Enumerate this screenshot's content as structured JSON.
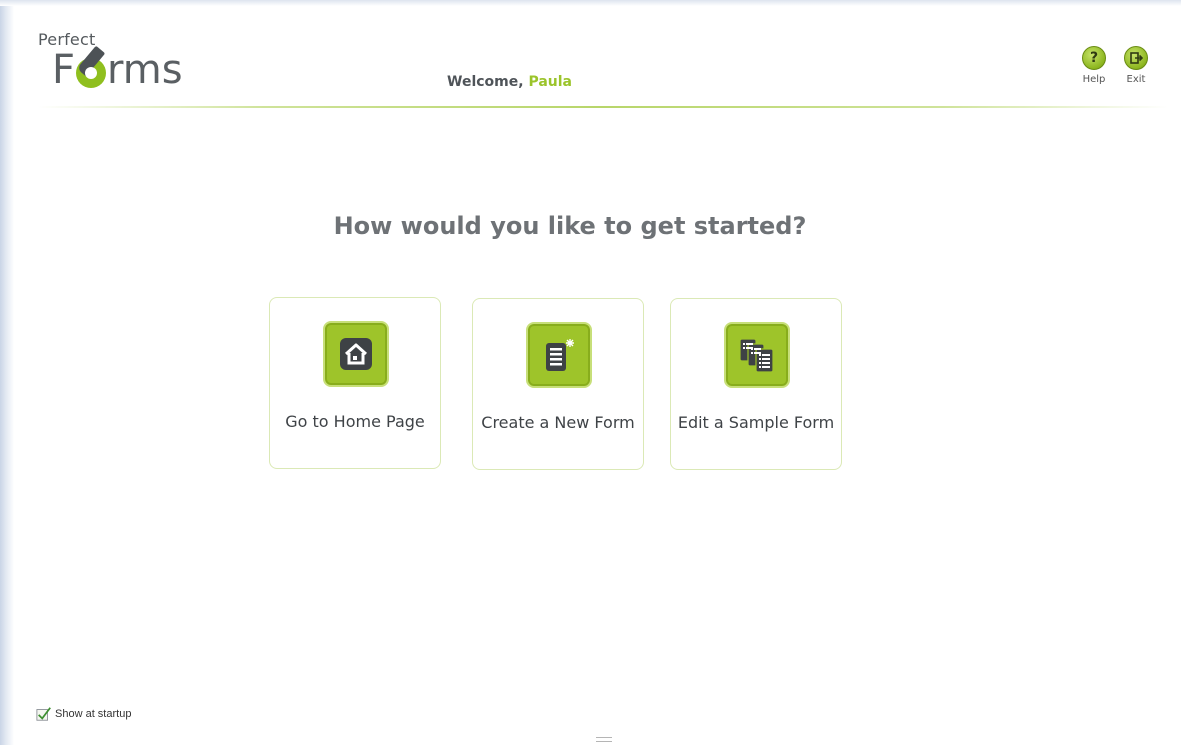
{
  "logo": {
    "line1": "Perfect",
    "letter_before": "F",
    "letters_after": "rms"
  },
  "header": {
    "welcome_prefix": "Welcome, ",
    "user_name": "Paula",
    "help_label": "Help",
    "exit_label": "Exit",
    "help_glyph": "?",
    "exit_icon": "exit-door-icon"
  },
  "main": {
    "heading": "How would you like to get started?",
    "options": [
      {
        "label": "Go to Home Page",
        "icon": "home-icon"
      },
      {
        "label": "Create a New Form",
        "icon": "new-form-icon"
      },
      {
        "label": "Edit a Sample Form",
        "icon": "sample-forms-icon"
      }
    ]
  },
  "footer": {
    "show_at_startup_label": "Show at startup",
    "show_at_startup_checked": true
  },
  "colors": {
    "accent": "#9bc42b",
    "text": "#4f5459",
    "heading": "#6e7276",
    "card_border": "#dbe9b6"
  }
}
